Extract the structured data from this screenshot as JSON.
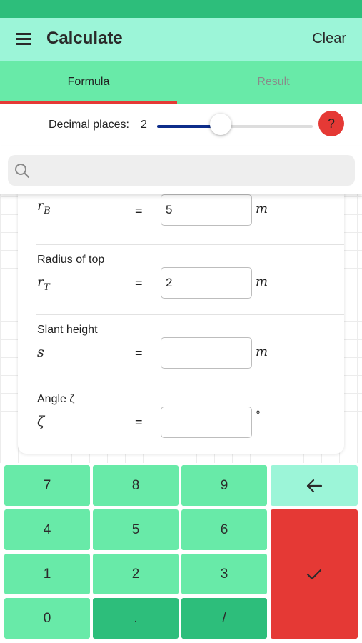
{
  "header": {
    "title": "Calculate",
    "clear_label": "Clear"
  },
  "tabs": [
    {
      "label": "Formula",
      "active": true
    },
    {
      "label": "Result",
      "active": false
    }
  ],
  "decimal": {
    "label": "Decimal places:",
    "value": "2",
    "slider_fraction": 0.41,
    "help_label": "?"
  },
  "search": {
    "placeholder": ""
  },
  "fields": [
    {
      "label": "",
      "symbol": "r",
      "subscript": "B",
      "value": "5",
      "unit": "m"
    },
    {
      "label": "Radius of top",
      "symbol": "r",
      "subscript": "T",
      "value": "2",
      "unit": "m"
    },
    {
      "label": "Slant height",
      "symbol": "s",
      "subscript": "",
      "value": "",
      "unit": "m"
    },
    {
      "label": "Angle ζ",
      "symbol": "ζ",
      "subscript": "",
      "value": "",
      "unit": "°"
    }
  ],
  "equals_sign": "=",
  "keypad": {
    "k7": "7",
    "k8": "8",
    "k9": "9",
    "k4": "4",
    "k5": "5",
    "k6": "6",
    "k1": "1",
    "k2": "2",
    "k3": "3",
    "k0": "0",
    "dot": ".",
    "slash": "/"
  },
  "colors": {
    "status_bar": "#2dbe7b",
    "app_bar": "#9cf5d8",
    "tab_bar": "#68eaa8",
    "accent_red": "#e53935",
    "slider_fill": "#0d2d8a",
    "key": "#68eaa8",
    "key_dark": "#2dbe7b"
  },
  "icons": {
    "menu": "hamburger-icon",
    "search": "search-icon",
    "backspace": "arrow-left-icon",
    "enter": "checkmark-icon"
  }
}
